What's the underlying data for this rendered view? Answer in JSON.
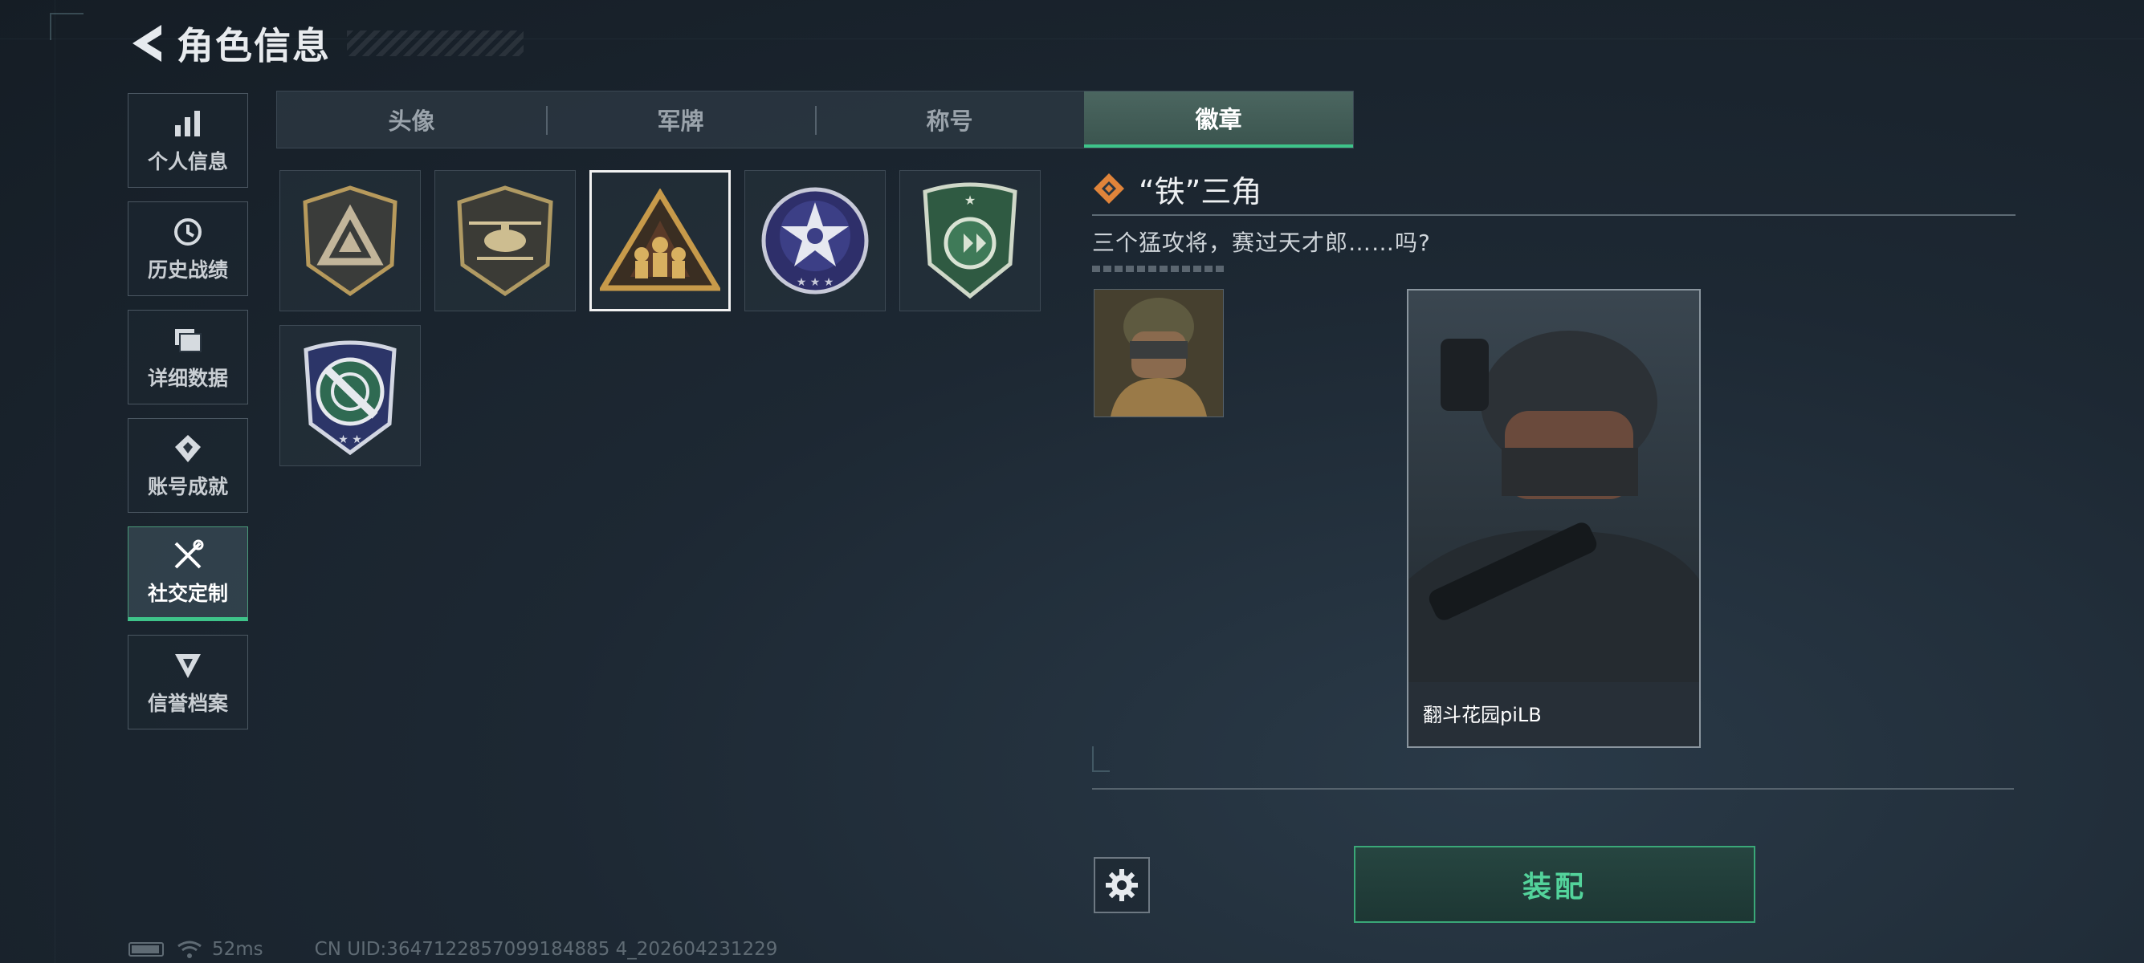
{
  "header": {
    "title": "角色信息",
    "back_icon": "back-arrow-icon"
  },
  "sidenav": {
    "items": [
      {
        "label": "个人信息",
        "icon": "bar-chart-icon",
        "active": false
      },
      {
        "label": "历史战绩",
        "icon": "clock-icon",
        "active": false
      },
      {
        "label": "详细数据",
        "icon": "folder-icon",
        "active": false
      },
      {
        "label": "账号成就",
        "icon": "medal-icon",
        "active": false
      },
      {
        "label": "社交定制",
        "icon": "tools-icon",
        "active": true
      },
      {
        "label": "信誉档案",
        "icon": "credit-shield-icon",
        "active": false
      }
    ]
  },
  "tabs": [
    {
      "label": "头像",
      "active": false
    },
    {
      "label": "军牌",
      "active": false
    },
    {
      "label": "称号",
      "active": false
    },
    {
      "label": "徽章",
      "active": true
    }
  ],
  "badges": [
    {
      "name": "triangle-emblem-badge",
      "selected": false
    },
    {
      "name": "helicopter-badge",
      "selected": false
    },
    {
      "name": "iron-triangle-badge",
      "selected": true
    },
    {
      "name": "star-seal-badge",
      "selected": false
    },
    {
      "name": "green-shield-badge",
      "selected": false
    },
    {
      "name": "crosshair-knife-badge",
      "selected": false
    }
  ],
  "detail": {
    "title": "“铁”三角",
    "description": "三个猛攻将，赛过天才郎……吗?",
    "card_name": "翻斗花园piLB"
  },
  "actions": {
    "equip_label": "装配",
    "settings_icon": "gear-icon"
  },
  "status": {
    "ping": "52ms",
    "uid": "CN UID:3647122857099184885 4_202604231229"
  },
  "colors": {
    "accent": "#3ec48a",
    "rarity": "#e0843a",
    "background": "#1d2833"
  }
}
